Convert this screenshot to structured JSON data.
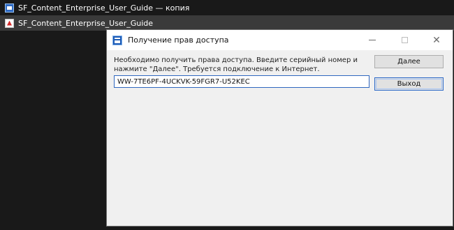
{
  "explorer": {
    "items": [
      {
        "label": "SF_Content_Enterprise_User_Guide — копия",
        "icon": "shortcut-file-icon"
      },
      {
        "label": "SF_Content_Enterprise_User_Guide",
        "icon": "pdf-file-icon"
      }
    ]
  },
  "dialog": {
    "title": "Получение прав доступа",
    "icon": "app-icon",
    "message": "Необходимо получить права доступа. Введите серийный номер и нажмите \"Далее\". Требуется подключение к Интернет.",
    "serial_value": "WW-7TE6PF-4UCKVK-59FGR7-U52KEC",
    "buttons": {
      "next": "Далее",
      "exit": "Выход"
    },
    "window_controls": {
      "minimize": "minimize-icon",
      "maximize": "maximize-icon",
      "close": "close-icon"
    }
  },
  "colors": {
    "desktop_bg": "#191919",
    "selected_row_bg": "#3a3a3a",
    "dialog_bg": "#f0f0f0",
    "input_border": "#2f67bf",
    "button_bg": "#e1e1e1"
  }
}
